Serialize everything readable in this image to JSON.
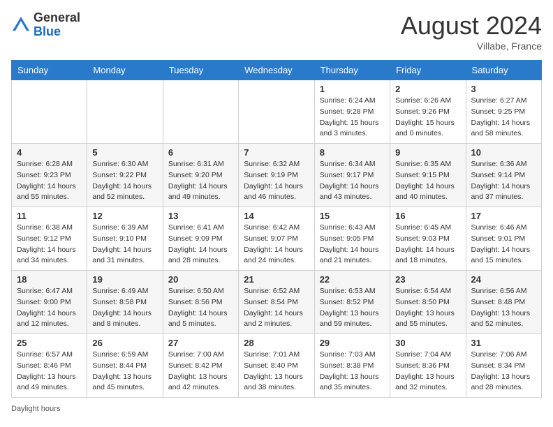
{
  "logo": {
    "general": "General",
    "blue": "Blue"
  },
  "header": {
    "month": "August 2024",
    "location": "Villabe, France"
  },
  "weekdays": [
    "Sunday",
    "Monday",
    "Tuesday",
    "Wednesday",
    "Thursday",
    "Friday",
    "Saturday"
  ],
  "weeks": [
    [
      {
        "day": "",
        "info": ""
      },
      {
        "day": "",
        "info": ""
      },
      {
        "day": "",
        "info": ""
      },
      {
        "day": "",
        "info": ""
      },
      {
        "day": "1",
        "info": "Sunrise: 6:24 AM\nSunset: 9:28 PM\nDaylight: 15 hours\nand 3 minutes."
      },
      {
        "day": "2",
        "info": "Sunrise: 6:26 AM\nSunset: 9:26 PM\nDaylight: 15 hours\nand 0 minutes."
      },
      {
        "day": "3",
        "info": "Sunrise: 6:27 AM\nSunset: 9:25 PM\nDaylight: 14 hours\nand 58 minutes."
      }
    ],
    [
      {
        "day": "4",
        "info": "Sunrise: 6:28 AM\nSunset: 9:23 PM\nDaylight: 14 hours\nand 55 minutes."
      },
      {
        "day": "5",
        "info": "Sunrise: 6:30 AM\nSunset: 9:22 PM\nDaylight: 14 hours\nand 52 minutes."
      },
      {
        "day": "6",
        "info": "Sunrise: 6:31 AM\nSunset: 9:20 PM\nDaylight: 14 hours\nand 49 minutes."
      },
      {
        "day": "7",
        "info": "Sunrise: 6:32 AM\nSunset: 9:19 PM\nDaylight: 14 hours\nand 46 minutes."
      },
      {
        "day": "8",
        "info": "Sunrise: 6:34 AM\nSunset: 9:17 PM\nDaylight: 14 hours\nand 43 minutes."
      },
      {
        "day": "9",
        "info": "Sunrise: 6:35 AM\nSunset: 9:15 PM\nDaylight: 14 hours\nand 40 minutes."
      },
      {
        "day": "10",
        "info": "Sunrise: 6:36 AM\nSunset: 9:14 PM\nDaylight: 14 hours\nand 37 minutes."
      }
    ],
    [
      {
        "day": "11",
        "info": "Sunrise: 6:38 AM\nSunset: 9:12 PM\nDaylight: 14 hours\nand 34 minutes."
      },
      {
        "day": "12",
        "info": "Sunrise: 6:39 AM\nSunset: 9:10 PM\nDaylight: 14 hours\nand 31 minutes."
      },
      {
        "day": "13",
        "info": "Sunrise: 6:41 AM\nSunset: 9:09 PM\nDaylight: 14 hours\nand 28 minutes."
      },
      {
        "day": "14",
        "info": "Sunrise: 6:42 AM\nSunset: 9:07 PM\nDaylight: 14 hours\nand 24 minutes."
      },
      {
        "day": "15",
        "info": "Sunrise: 6:43 AM\nSunset: 9:05 PM\nDaylight: 14 hours\nand 21 minutes."
      },
      {
        "day": "16",
        "info": "Sunrise: 6:45 AM\nSunset: 9:03 PM\nDaylight: 14 hours\nand 18 minutes."
      },
      {
        "day": "17",
        "info": "Sunrise: 6:46 AM\nSunset: 9:01 PM\nDaylight: 14 hours\nand 15 minutes."
      }
    ],
    [
      {
        "day": "18",
        "info": "Sunrise: 6:47 AM\nSunset: 9:00 PM\nDaylight: 14 hours\nand 12 minutes."
      },
      {
        "day": "19",
        "info": "Sunrise: 6:49 AM\nSunset: 8:58 PM\nDaylight: 14 hours\nand 8 minutes."
      },
      {
        "day": "20",
        "info": "Sunrise: 6:50 AM\nSunset: 8:56 PM\nDaylight: 14 hours\nand 5 minutes."
      },
      {
        "day": "21",
        "info": "Sunrise: 6:52 AM\nSunset: 8:54 PM\nDaylight: 14 hours\nand 2 minutes."
      },
      {
        "day": "22",
        "info": "Sunrise: 6:53 AM\nSunset: 8:52 PM\nDaylight: 13 hours\nand 59 minutes."
      },
      {
        "day": "23",
        "info": "Sunrise: 6:54 AM\nSunset: 8:50 PM\nDaylight: 13 hours\nand 55 minutes."
      },
      {
        "day": "24",
        "info": "Sunrise: 6:56 AM\nSunset: 8:48 PM\nDaylight: 13 hours\nand 52 minutes."
      }
    ],
    [
      {
        "day": "25",
        "info": "Sunrise: 6:57 AM\nSunset: 8:46 PM\nDaylight: 13 hours\nand 49 minutes."
      },
      {
        "day": "26",
        "info": "Sunrise: 6:59 AM\nSunset: 8:44 PM\nDaylight: 13 hours\nand 45 minutes."
      },
      {
        "day": "27",
        "info": "Sunrise: 7:00 AM\nSunset: 8:42 PM\nDaylight: 13 hours\nand 42 minutes."
      },
      {
        "day": "28",
        "info": "Sunrise: 7:01 AM\nSunset: 8:40 PM\nDaylight: 13 hours\nand 38 minutes."
      },
      {
        "day": "29",
        "info": "Sunrise: 7:03 AM\nSunset: 8:38 PM\nDaylight: 13 hours\nand 35 minutes."
      },
      {
        "day": "30",
        "info": "Sunrise: 7:04 AM\nSunset: 8:36 PM\nDaylight: 13 hours\nand 32 minutes."
      },
      {
        "day": "31",
        "info": "Sunrise: 7:06 AM\nSunset: 8:34 PM\nDaylight: 13 hours\nand 28 minutes."
      }
    ]
  ],
  "footer": {
    "daylight_label": "Daylight hours"
  }
}
